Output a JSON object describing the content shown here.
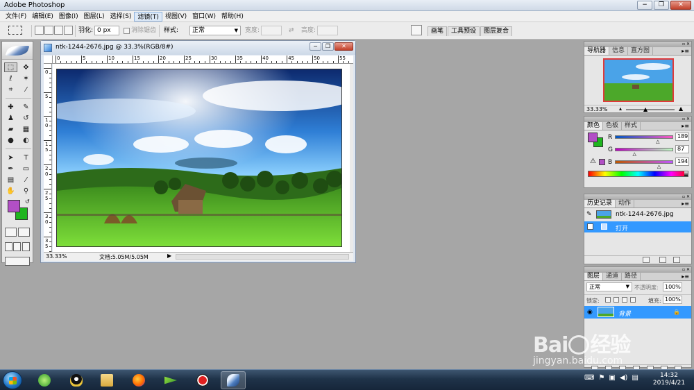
{
  "window": {
    "title": "Adobe Photoshop",
    "min": "−",
    "max": "❐",
    "close": "✕"
  },
  "menu": [
    {
      "label": "文件(F)"
    },
    {
      "label": "编辑(E)"
    },
    {
      "label": "图像(I)"
    },
    {
      "label": "图层(L)"
    },
    {
      "label": "选择(S)"
    },
    {
      "label": "滤镜(T)"
    },
    {
      "label": "视图(V)"
    },
    {
      "label": "窗口(W)"
    },
    {
      "label": "帮助(H)"
    }
  ],
  "options_bar": {
    "feather_label": "羽化:",
    "feather_value": "0 px",
    "antialias_label": "消除锯齿",
    "style_label": "样式:",
    "style_value": "正常",
    "width_label": "宽度:",
    "height_label": "高度:",
    "dock_tabs": [
      "画笔",
      "工具预设",
      "图层复合"
    ]
  },
  "document": {
    "title": "ntk-1244-2676.jpg @ 33.3%(RGB/8#)",
    "zoom": "33.33%",
    "doc_info": "文档:5.05M/5.05M",
    "ruler_h": [
      "0",
      "5",
      "10",
      "15",
      "20",
      "25",
      "30",
      "35",
      "40",
      "45",
      "50",
      "55"
    ],
    "ruler_v": [
      "0",
      "5",
      "1 0",
      "1 5",
      "2 0",
      "2 5",
      "3 0",
      "3 5"
    ]
  },
  "navigator": {
    "tabs": [
      "导航器",
      "信息",
      "直方图"
    ],
    "zoom": "33.33%"
  },
  "color_panel": {
    "tabs": [
      "颜色",
      "色板",
      "样式"
    ],
    "fg": "#b24fc5",
    "bg": "#1fb51f",
    "channels": [
      {
        "label": "R",
        "value": "189",
        "pos": 0.74
      },
      {
        "label": "G",
        "value": "87",
        "pos": 0.34
      },
      {
        "label": "B",
        "value": "194",
        "pos": 0.76
      }
    ]
  },
  "history": {
    "tabs": [
      "历史记录",
      "动作"
    ],
    "snapshot": "ntk-1244-2676.jpg",
    "step": "打开"
  },
  "layers": {
    "tabs": [
      "图层",
      "通道",
      "路径"
    ],
    "blend": "正常",
    "opacity_label": "不透明度:",
    "opacity": "100%",
    "lock_label": "锁定:",
    "fill_label": "填充:",
    "fill": "100%",
    "layer_name": "背景"
  },
  "taskbar": {
    "time": "14:32",
    "date": "2019/4/21"
  },
  "watermark": {
    "logo_a": "Bai",
    "logo_b": "经验",
    "url": "jingyan.baidu.com"
  }
}
